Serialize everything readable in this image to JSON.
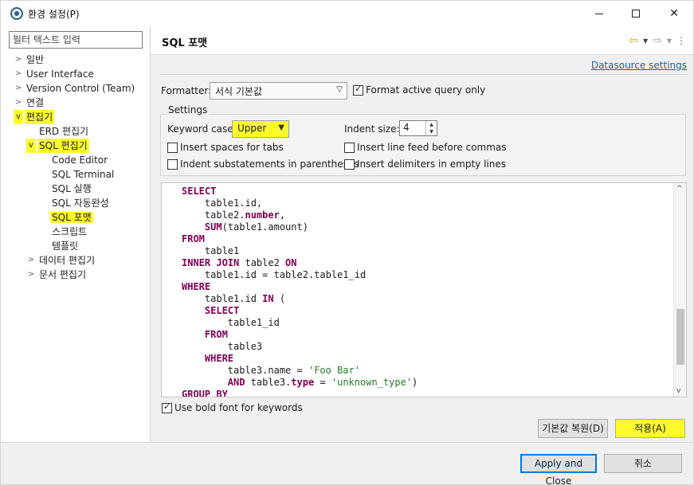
{
  "window": {
    "title": "환경 설정(P)",
    "controls": {
      "minimize": "minimize",
      "maximize": "maximize",
      "close": "✕"
    }
  },
  "filter": {
    "placeholder": "필터 텍스트 입력"
  },
  "tree": {
    "items": [
      {
        "label": "일반",
        "expanded": false,
        "highlighted": false
      },
      {
        "label": "User Interface",
        "expanded": false,
        "highlighted": false
      },
      {
        "label": "Version Control (Team)",
        "expanded": false,
        "highlighted": false
      },
      {
        "label": "연결",
        "expanded": false,
        "highlighted": false
      },
      {
        "label": "편집기",
        "expanded": true,
        "highlighted": true
      },
      {
        "label": "ERD 편집기",
        "expanded": null,
        "highlighted": false
      },
      {
        "label": "SQL 편집기",
        "expanded": true,
        "highlighted": true
      },
      {
        "label": "Code Editor",
        "expanded": null,
        "highlighted": false
      },
      {
        "label": "SQL Terminal",
        "expanded": null,
        "highlighted": false
      },
      {
        "label": "SQL 실행",
        "expanded": null,
        "highlighted": false
      },
      {
        "label": "SQL 자동완성",
        "expanded": null,
        "highlighted": false
      },
      {
        "label": "SQL 포맷",
        "expanded": null,
        "highlighted": true,
        "selected": true
      },
      {
        "label": "스크립트",
        "expanded": null,
        "highlighted": false
      },
      {
        "label": "템플릿",
        "expanded": null,
        "highlighted": false
      },
      {
        "label": "데이터 편집기",
        "expanded": false,
        "highlighted": false
      },
      {
        "label": "문서 편집기",
        "expanded": false,
        "highlighted": false
      }
    ]
  },
  "page": {
    "title": "SQL 포맷",
    "datasource_link": "Datasource settings",
    "formatter": {
      "label": "Formatter:",
      "value": "서식 기본값",
      "format_active_query_label": "Format active query only",
      "format_active_query_checked": true
    },
    "settings": {
      "group_label": "Settings",
      "keyword_case_label": "Keyword case:",
      "keyword_case_value": "Upper",
      "indent_size_label": "Indent size:",
      "indent_size_value": "4",
      "insert_spaces_label": "Insert spaces for tabs",
      "insert_spaces_checked": false,
      "insert_line_feed_label": "Insert line feed before commas",
      "insert_line_feed_checked": false,
      "indent_substatements_label": "Indent substatements in parentheses",
      "indent_substatements_checked": false,
      "insert_delimiters_label": "Insert delimiters in empty lines",
      "insert_delimiters_checked": false
    },
    "preview_lines": [
      [
        {
          "t": "kw",
          "v": "SELECT"
        }
      ],
      [
        {
          "t": "txt",
          "v": "    table1.id,"
        }
      ],
      [
        {
          "t": "txt",
          "v": "    table2."
        },
        {
          "t": "kw",
          "v": "number"
        },
        {
          "t": "txt",
          "v": ","
        }
      ],
      [
        {
          "t": "txt",
          "v": "    "
        },
        {
          "t": "kw",
          "v": "SUM"
        },
        {
          "t": "txt",
          "v": "(table1.amount)"
        }
      ],
      [
        {
          "t": "kw",
          "v": "FROM"
        }
      ],
      [
        {
          "t": "txt",
          "v": "    table1"
        }
      ],
      [
        {
          "t": "kw",
          "v": "INNER JOIN"
        },
        {
          "t": "txt",
          "v": " table2 "
        },
        {
          "t": "kw",
          "v": "ON"
        }
      ],
      [
        {
          "t": "txt",
          "v": "    table1.id = table2.table1_id"
        }
      ],
      [
        {
          "t": "kw",
          "v": "WHERE"
        }
      ],
      [
        {
          "t": "txt",
          "v": "    table1.id "
        },
        {
          "t": "kw",
          "v": "IN"
        },
        {
          "t": "txt",
          "v": " ("
        }
      ],
      [
        {
          "t": "txt",
          "v": "    "
        },
        {
          "t": "kw",
          "v": "SELECT"
        }
      ],
      [
        {
          "t": "txt",
          "v": "        table1_id"
        }
      ],
      [
        {
          "t": "txt",
          "v": "    "
        },
        {
          "t": "kw",
          "v": "FROM"
        }
      ],
      [
        {
          "t": "txt",
          "v": "        table3"
        }
      ],
      [
        {
          "t": "txt",
          "v": "    "
        },
        {
          "t": "kw",
          "v": "WHERE"
        }
      ],
      [
        {
          "t": "txt",
          "v": "        table3.name = "
        },
        {
          "t": "str",
          "v": "'Foo Bar'"
        }
      ],
      [
        {
          "t": "txt",
          "v": "        "
        },
        {
          "t": "kw",
          "v": "AND"
        },
        {
          "t": "txt",
          "v": " table3."
        },
        {
          "t": "kw",
          "v": "type"
        },
        {
          "t": "txt",
          "v": " = "
        },
        {
          "t": "str",
          "v": "'unknown_type'"
        },
        {
          "t": "txt",
          "v": ")"
        }
      ],
      [
        {
          "t": "kw",
          "v": "GROUP BY"
        }
      ]
    ],
    "bold_keywords_label": "Use bold font for keywords",
    "bold_keywords_checked": true,
    "restore_defaults_label": "기본값 복원(D)",
    "apply_label": "적용(A)"
  },
  "footer": {
    "apply_close_label": "Apply and Close",
    "cancel_label": "취소"
  },
  "colors": {
    "keyword": "#7f0055",
    "string": "#2a7a2a",
    "highlight": "#fbfb2c",
    "link": "#1a5fb4",
    "primary_border": "#0078d7"
  },
  "icons": {
    "window": "app-icon",
    "nav_back": "arrow-left-icon",
    "nav_forward": "arrow-right-icon",
    "menu": "kebab-menu-icon"
  }
}
